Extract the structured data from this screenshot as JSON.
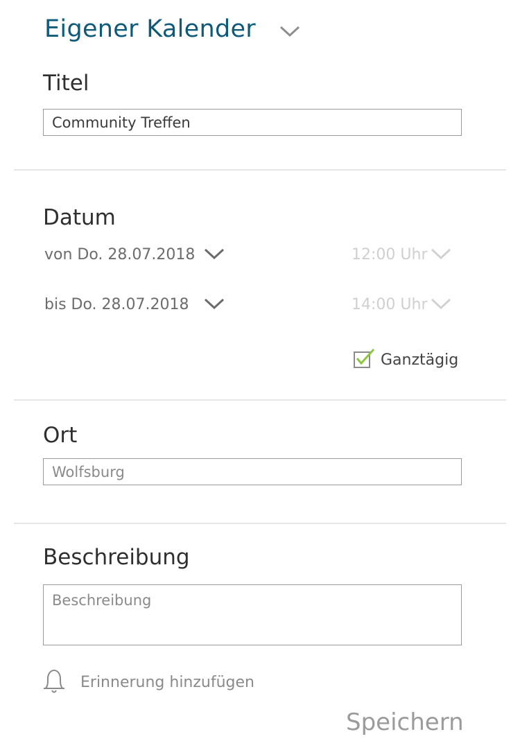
{
  "calendar": {
    "name": "Eigener Kalender",
    "icon": "chevron-down-icon"
  },
  "title_section": {
    "label": "Titel",
    "value": "Community Treffen"
  },
  "date_section": {
    "label": "Datum",
    "from_date": "von Do. 28.07.2018",
    "from_time": "12:00 Uhr",
    "to_date": "bis Do. 28.07.2018",
    "to_time": "14:00 Uhr",
    "all_day_label": "Ganztägig",
    "all_day_checked": true
  },
  "location_section": {
    "label": "Ort",
    "placeholder": "Wolfsburg"
  },
  "description_section": {
    "label": "Beschreibung",
    "placeholder": "Beschreibung"
  },
  "reminder": {
    "label": "Erinnerung hinzufügen",
    "icon": "bell-icon"
  },
  "save_label": "Speichern",
  "colors": {
    "accent": "#0e5a78",
    "check": "#8cc63f",
    "divider": "#e6e6e6"
  }
}
